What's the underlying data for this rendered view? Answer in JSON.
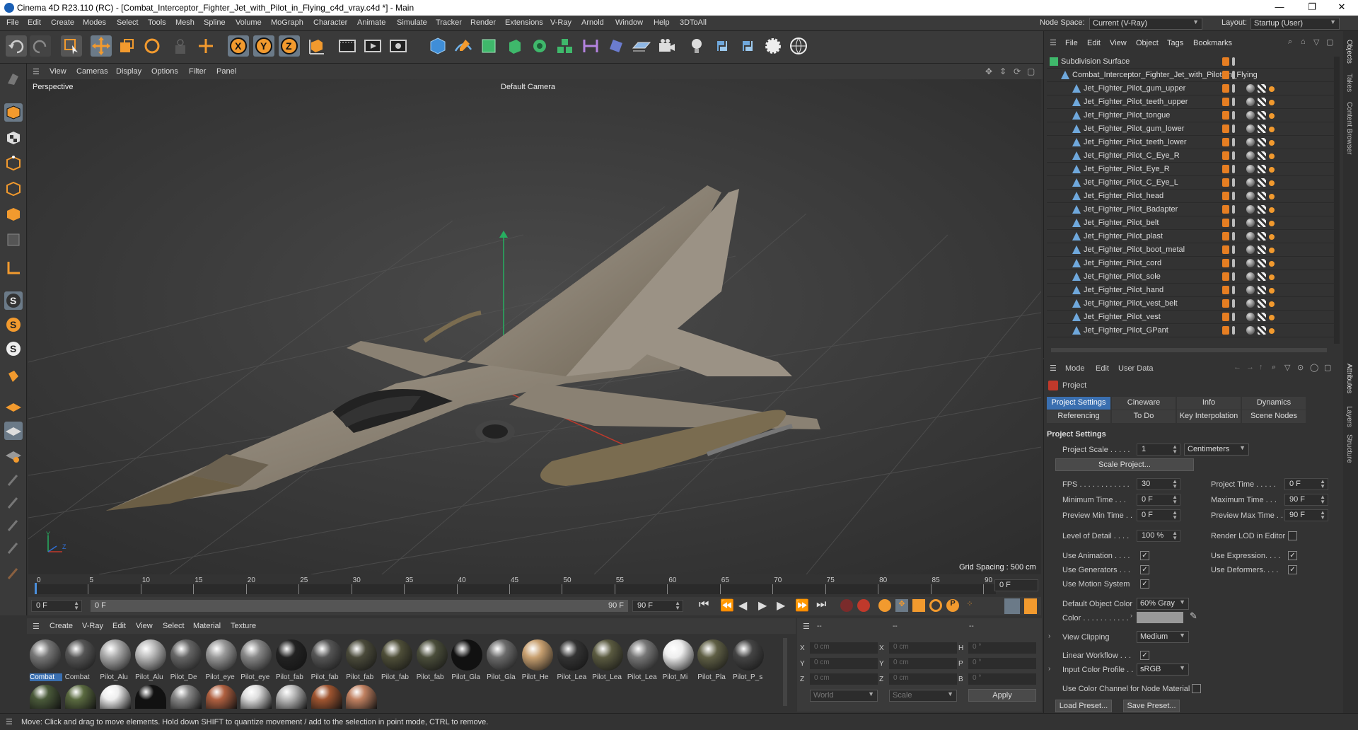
{
  "window": {
    "title": "Cinema 4D R23.110 (RC) - [Combat_Interceptor_Fighter_Jet_with_Pilot_in_Flying_c4d_vray.c4d *] - Main",
    "controls": [
      "—",
      "❐",
      "✕"
    ]
  },
  "menubar": {
    "items": [
      "File",
      "Edit",
      "Create",
      "Modes",
      "Select",
      "Tools",
      "Mesh",
      "Spline",
      "Volume",
      "MoGraph",
      "Character",
      "Animate",
      "Simulate",
      "Tracker",
      "Render",
      "Extensions",
      "V-Ray",
      "Arnold",
      "Window",
      "Help",
      "3DToAll"
    ],
    "node_space_label": "Node Space:",
    "node_space_value": "Current (V-Ray)",
    "layout_label": "Layout:",
    "layout_value": "Startup (User)"
  },
  "viewport": {
    "menu": [
      "View",
      "Cameras",
      "Display",
      "Options",
      "Filter",
      "Panel"
    ],
    "name": "Perspective",
    "camera": "Default Camera",
    "grid_spacing": "Grid Spacing : 500 cm",
    "axis_y": "Y",
    "axis_z": "Z",
    "axis_x": "X"
  },
  "timeline": {
    "ticks": [
      "0",
      "5",
      "10",
      "15",
      "20",
      "25",
      "30",
      "35",
      "40",
      "45",
      "50",
      "55",
      "60",
      "65",
      "70",
      "75",
      "80",
      "85",
      "90"
    ],
    "current_frame": "0 F",
    "start": "0 F",
    "range_start": "0 F",
    "range_end": "90 F",
    "end": "90 F"
  },
  "material_manager": {
    "menu": [
      "Create",
      "V-Ray",
      "Edit",
      "View",
      "Select",
      "Material",
      "Texture"
    ],
    "materials_row1": [
      "Combat",
      "Combat",
      "Pilot_Alu",
      "Pilot_Alu",
      "Pilot_De",
      "Pilot_eye",
      "Pilot_eye",
      "Pilot_fab",
      "Pilot_fab",
      "Pilot_fab",
      "Pilot_fab",
      "Pilot_fab",
      "Pilot_Gla",
      "Pilot_Gla",
      "Pilot_He",
      "Pilot_Lea",
      "Pilot_Lea",
      "Pilot_Lea",
      "Pilot_Mi",
      "Pilot_Pla",
      "Pilot_P_s"
    ],
    "row2_count_note": ""
  },
  "coordinates": {
    "header_left": "--",
    "header_mid": "--",
    "header_right": "--",
    "rows": [
      {
        "l1": "X",
        "v1": "0 cm",
        "l2": "X",
        "v2": "0 cm",
        "l3": "H",
        "v3": "0 °"
      },
      {
        "l1": "Y",
        "v1": "0 cm",
        "l2": "Y",
        "v2": "0 cm",
        "l3": "P",
        "v3": "0 °"
      },
      {
        "l1": "Z",
        "v1": "0 cm",
        "l2": "Z",
        "v2": "0 cm",
        "l3": "B",
        "v3": "0 °"
      }
    ],
    "mode1": "World",
    "mode2": "Scale",
    "apply": "Apply"
  },
  "status": "Move: Click and drag to move elements. Hold down SHIFT to quantize movement / add to the selection in point mode, CTRL to remove.",
  "object_manager": {
    "menu": [
      "File",
      "Edit",
      "View",
      "Object",
      "Tags",
      "Bookmarks"
    ],
    "root": "Subdivision Surface",
    "group": "Combat_Interceptor_Fighter_Jet_with_Pilot_in_Flying",
    "children": [
      "Jet_Fighter_Pilot_gum_upper",
      "Jet_Fighter_Pilot_teeth_upper",
      "Jet_Fighter_Pilot_tongue",
      "Jet_Fighter_Pilot_gum_lower",
      "Jet_Fighter_Pilot_teeth_lower",
      "Jet_Fighter_Pilot_C_Eye_R",
      "Jet_Fighter_Pilot_Eye_R",
      "Jet_Fighter_Pilot_C_Eye_L",
      "Jet_Fighter_Pilot_head",
      "Jet_Fighter_Pilot_Badapter",
      "Jet_Fighter_Pilot_belt",
      "Jet_Fighter_Pilot_plast",
      "Jet_Fighter_Pilot_boot_metal",
      "Jet_Fighter_Pilot_cord",
      "Jet_Fighter_Pilot_sole",
      "Jet_Fighter_Pilot_hand",
      "Jet_Fighter_Pilot_vest_belt",
      "Jet_Fighter_Pilot_vest",
      "Jet_Fighter_Pilot_GPant"
    ]
  },
  "attributes": {
    "menu": [
      "Mode",
      "Edit",
      "User Data"
    ],
    "object": "Project",
    "tabs_row1": [
      "Project Settings",
      "Cineware",
      "Info",
      "Dynamics"
    ],
    "tabs_row2": [
      "Referencing",
      "To Do",
      "Key Interpolation",
      "Scene Nodes"
    ],
    "section": "Project Settings",
    "project_scale_label": "Project Scale . . . . .",
    "project_scale_value": "1",
    "project_scale_unit": "Centimeters",
    "scale_project_btn": "Scale Project...",
    "fps_label": "FPS . . . . . . . . . . . .",
    "fps_value": "30",
    "project_time_label": "Project Time . . . . .",
    "project_time_value": "0 F",
    "min_time_label": "Minimum Time . . .",
    "min_time_value": "0 F",
    "max_time_label": "Maximum Time . . .",
    "max_time_value": "90 F",
    "prev_min_label": "Preview Min Time . .",
    "prev_min_value": "0 F",
    "prev_max_label": "Preview Max Time . .",
    "prev_max_value": "90 F",
    "lod_label": "Level of Detail . . . .",
    "lod_value": "100 %",
    "render_lod_label": "Render LOD in Editor",
    "use_anim_label": "Use Animation . . . .",
    "use_expr_label": "Use Expression. . . .",
    "use_gen_label": "Use Generators . . .",
    "use_def_label": "Use Deformers. . . .",
    "use_motion_label": "Use Motion System",
    "def_color_label": "Default Object Color",
    "def_color_value": "60% Gray",
    "color_label": "Color . . . . . . . . . . .",
    "view_clip_label": "View Clipping",
    "view_clip_value": "Medium",
    "linear_label": "Linear Workflow . . .",
    "input_profile_label": "Input Color Profile . .",
    "input_profile_value": "sRGB",
    "use_color_channel_label": "Use Color Channel for Node Material",
    "load_preset": "Load Preset...",
    "save_preset": "Save Preset...",
    "check": "✓"
  },
  "right_tabs": [
    "Objects",
    "Takes",
    "Content Browser",
    "Attributes",
    "Layers",
    "Structure"
  ]
}
